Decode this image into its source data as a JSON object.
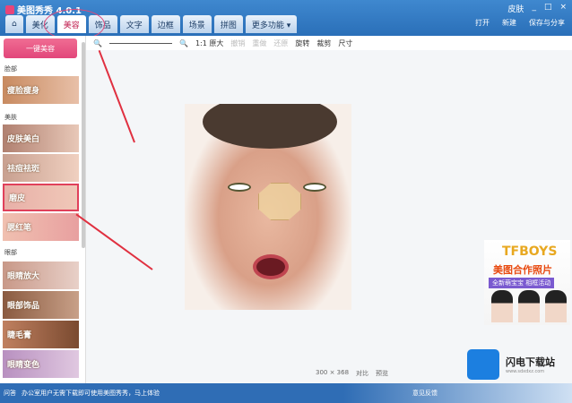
{
  "app": {
    "title": "美图秀秀 4.0.1"
  },
  "window_controls": [
    "皮肤",
    "_",
    "□",
    "×"
  ],
  "tabs": [
    {
      "label": "⌂"
    },
    {
      "label": "美化"
    },
    {
      "label": "美容",
      "active": true
    },
    {
      "label": "饰品"
    },
    {
      "label": "文字"
    },
    {
      "label": "边框"
    },
    {
      "label": "场景"
    },
    {
      "label": "拼图"
    },
    {
      "label": "更多功能 ▾"
    }
  ],
  "right_tools": {
    "open": "打开",
    "new": "新建",
    "save": "保存与分享"
  },
  "toolbar": {
    "zoom_out": "🔍",
    "zoom_in": "🔍",
    "original": "1:1 原大",
    "undo": "撤销",
    "redo": "重做",
    "reset": "还原",
    "rotate": "旋转",
    "crop": "裁剪",
    "size": "尺寸"
  },
  "sidebar": {
    "one_key": "一键美容",
    "sections": [
      {
        "title": "脸部",
        "items": [
          "瘦脸瘦身"
        ]
      },
      {
        "title": "美肤",
        "items": [
          "皮肤美白",
          "祛痘祛斑",
          "磨皮",
          "腮红笔"
        ]
      },
      {
        "title": "眼部",
        "items": [
          "眼睛放大",
          "眼部饰品",
          "睫毛膏",
          "眼睛变色"
        ]
      }
    ]
  },
  "ad": {
    "title": "TFBOYS",
    "subtitle": "美图合作照片",
    "banner": "全新萌宝宝 相框活动"
  },
  "watermark": {
    "name": "闪电下载站",
    "url": "www.sdxdxz.com"
  },
  "image_info": {
    "size": "300 × 368",
    "compare": "对比",
    "preview": "预览"
  },
  "status": {
    "left": "问答",
    "message": "办公室用户无需下载即可使用美图秀秀，马上体验",
    "right": "意见反馈"
  },
  "colors": {
    "accent": "#e2467a",
    "titlebar": "#2a6fb8",
    "arrow": "#e03040"
  }
}
